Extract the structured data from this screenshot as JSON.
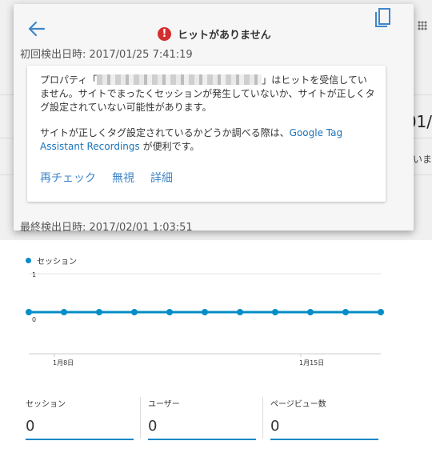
{
  "popup": {
    "title": "ヒットがありません",
    "first_detected": "初回検出日時: 2017/01/25 7:41:19",
    "last_detected": "最終検出日時: 2017/02/01 1:03:51",
    "message_before": "プロパティ「",
    "message_after": "」はヒットを受信していません。サイトでまったくセッションが発生していないか、サイトが正しくタグ設定されていない可能性があります。",
    "message2_before": "サイトが正しくタグ設定されているかどうか調べる際は、",
    "message2_link": "Google Tag Assistant Recordings",
    "message2_after": " が便利です。",
    "actions": [
      "再チェック",
      "無視",
      "詳細"
    ]
  },
  "background": {
    "fragment_1": "01/",
    "fragment_2": "いま"
  },
  "chart_data": {
    "type": "line",
    "series": [
      {
        "name": "セッション",
        "values": [
          0,
          0,
          0,
          0,
          0,
          0,
          0,
          0,
          0,
          0,
          0
        ]
      }
    ],
    "x_tick_labels": [
      {
        "label": "1月8日",
        "index": 1
      },
      {
        "label": "1月15日",
        "index": 8
      }
    ],
    "y_tick_labels": [
      "1",
      "0"
    ],
    "ylim": [
      0,
      1
    ],
    "color": "#058dc7",
    "grid": true,
    "legend": "top-left"
  },
  "metrics": [
    {
      "label": "セッション",
      "value": "0"
    },
    {
      "label": "ユーザー",
      "value": "0"
    },
    {
      "label": "ページビュー数",
      "value": "0"
    }
  ]
}
